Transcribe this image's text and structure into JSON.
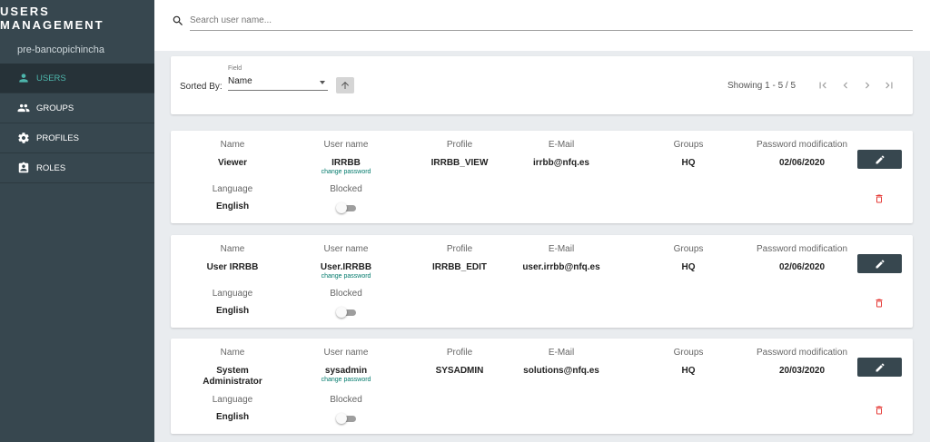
{
  "app": {
    "title": "USERS MANAGEMENT",
    "tenant": "pre-bancopichincha"
  },
  "nav": [
    {
      "label": "USERS",
      "icon": "person-icon",
      "active": true
    },
    {
      "label": "GROUPS",
      "icon": "people-icon",
      "active": false
    },
    {
      "label": "PROFILES",
      "icon": "gear-icon",
      "active": false
    },
    {
      "label": "ROLES",
      "icon": "badge-icon",
      "active": false
    }
  ],
  "search": {
    "placeholder": "Search user name...",
    "value": ""
  },
  "sort": {
    "label": "Sorted By:",
    "field_label": "Field",
    "field_value": "Name",
    "showing": "Showing 1 - 5 / 5"
  },
  "columns": {
    "name": "Name",
    "username": "User name",
    "profile": "Profile",
    "email": "E-Mail",
    "groups": "Groups",
    "password_mod": "Password modification",
    "language": "Language",
    "blocked": "Blocked"
  },
  "change_password_label": "change password",
  "users": [
    {
      "name_l1": "Viewer",
      "name_l2": "",
      "username": "IRRBB",
      "profile": "IRRBB_VIEW",
      "email": "irrbb@nfq.es",
      "groups": "HQ",
      "password_mod": "02/06/2020",
      "language": "English",
      "blocked": false
    },
    {
      "name_l1": "User IRRBB",
      "name_l2": "",
      "username": "User.IRRBB",
      "profile": "IRRBB_EDIT",
      "email": "user.irrbb@nfq.es",
      "groups": "HQ",
      "password_mod": "02/06/2020",
      "language": "English",
      "blocked": false
    },
    {
      "name_l1": "System",
      "name_l2": "Administrator",
      "username": "sysadmin",
      "profile": "SYSADMIN",
      "email": "solutions@nfq.es",
      "groups": "HQ",
      "password_mod": "20/03/2020",
      "language": "English",
      "blocked": false
    }
  ],
  "colors": {
    "sidebar": "#37474f",
    "sidebar_active": "#263238",
    "accent": "#4db6ac",
    "delete": "#e53935"
  }
}
